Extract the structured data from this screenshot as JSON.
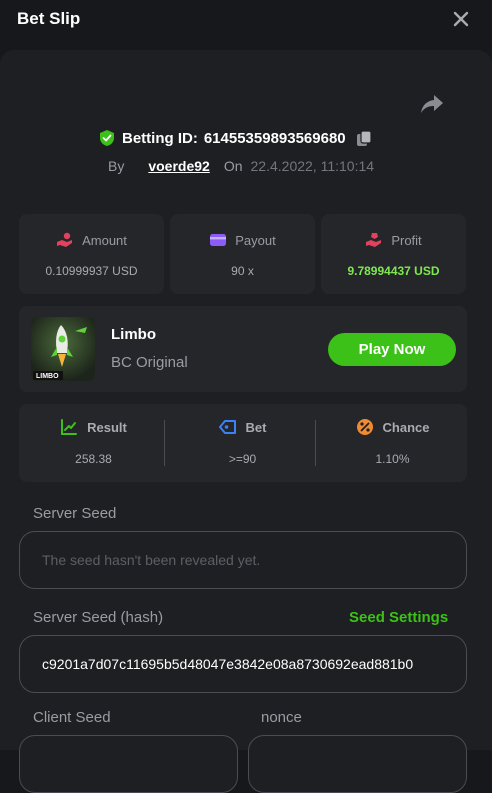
{
  "header": {
    "title": "Bet Slip",
    "close_icon": "close-icon"
  },
  "bet": {
    "id_label": "Betting ID:",
    "id_value": "61455359893569680",
    "by_label": "By",
    "username": "voerde92",
    "on_label": "On",
    "date": "22.4.2022, 11:10:14"
  },
  "stats": {
    "amount": {
      "label": "Amount",
      "value": "0.10999937 USD",
      "icon": "hand-coins-icon"
    },
    "payout": {
      "label": "Payout",
      "value": "90 x",
      "icon": "wallet-icon"
    },
    "profit": {
      "label": "Profit",
      "value": "9.78994437 USD",
      "icon": "hand-money-icon"
    }
  },
  "game": {
    "name": "Limbo",
    "subtitle": "BC Original",
    "thumb_text": "LIMBO",
    "play_label": "Play Now"
  },
  "result": {
    "result": {
      "label": "Result",
      "value": "258.38"
    },
    "bet": {
      "label": "Bet",
      "value": ">=90"
    },
    "chance": {
      "label": "Chance",
      "value": "1.10%"
    }
  },
  "seeds": {
    "server_seed_label": "Server Seed",
    "server_seed_placeholder": "The seed hasn't been revealed yet.",
    "server_hash_label": "Server Seed (hash)",
    "seed_settings_label": "Seed Settings",
    "server_hash_value": "c9201a7d07c11695b5d48047e3842e08a8730692ead881b0",
    "client_seed_label": "Client Seed",
    "nonce_label": "nonce"
  },
  "colors": {
    "accent_green": "#3bc117",
    "profit_green": "#7fe84f",
    "background": "#17181b",
    "panel": "#1e1f22",
    "card": "#25262a"
  }
}
